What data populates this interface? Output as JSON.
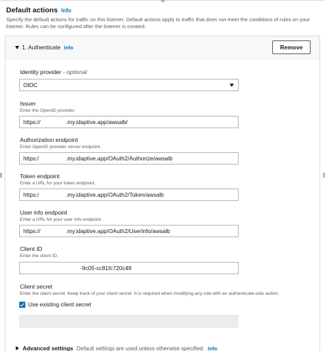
{
  "header": {
    "title": "Default actions",
    "info": "Info",
    "description": "Specify the default actions for traffic on this listener. Default actions apply to traffic that does not meet the conditions of rules on your listener. Rules can be configured after the listener is created."
  },
  "action": {
    "title": "1. Authenticate",
    "info": "Info",
    "remove_label": "Remove"
  },
  "identity_provider": {
    "label": "Identity provider",
    "optional": "optional",
    "value": "OIDC"
  },
  "issuer": {
    "label": "Issuer",
    "hint": "Enter the OpenID provider.",
    "prefix": "https://",
    "suffix": ".my.idaptive.app/awsalb/"
  },
  "authorization_endpoint": {
    "label": "Authorization endpoint",
    "hint": "Enter OpenID provider server endpoint.",
    "prefix": "https:/",
    "suffix": ".my.idaptive.app/OAuth2/Authorize/awsalb"
  },
  "token_endpoint": {
    "label": "Token endpoint",
    "hint": "Enter a URL for your token endpoint.",
    "prefix": "https:/",
    "suffix": ".my.idaptive.app/OAuth2/Token/awsalb"
  },
  "user_info_endpoint": {
    "label": "User info endpoint",
    "hint": "Enter a URL for your user info endpoint.",
    "prefix": "https://",
    "suffix": ".my.idaptive.app/OAuth2/UserInfo/awsalb"
  },
  "client_id": {
    "label": "Client ID",
    "hint": "Enter the client ID.",
    "value": "-9c05-cc81fc720c48"
  },
  "client_secret": {
    "label": "Client secret",
    "hint": "Enter the client secret. Keep track of your client secret. It is required when modifying any rule with an authenticate-oidc action.",
    "checkbox_label": "Use existing client secret",
    "checked": true
  },
  "advanced": {
    "title": "Advanced settings",
    "description": "Default settings are used unless otherwise specified.",
    "info": "Info"
  },
  "colors": {
    "accent": "#0073bb",
    "text": "#16191f",
    "muted": "#545b64",
    "border": "#aab7b8"
  }
}
